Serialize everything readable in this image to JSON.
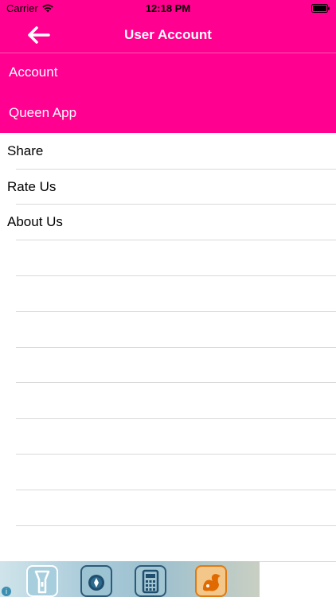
{
  "status_bar": {
    "carrier": "Carrier",
    "time": "12:18 PM"
  },
  "nav_bar": {
    "title": "User Account",
    "back_icon": "back-arrow-icon"
  },
  "menu": {
    "items": [
      {
        "label": "Account"
      },
      {
        "label": "Queen App"
      }
    ]
  },
  "list": {
    "items": [
      {
        "label": "Share"
      },
      {
        "label": "Rate Us"
      },
      {
        "label": "About Us"
      }
    ]
  },
  "ad_banner": {
    "icons": [
      "flashlight-icon",
      "compass-icon",
      "calculator-icon",
      "squirrel-browser-icon"
    ]
  },
  "colors": {
    "brand": "#ff0090",
    "text_on_brand": "#ffffff",
    "list_text": "#000000",
    "separator": "#d9d9d9"
  }
}
